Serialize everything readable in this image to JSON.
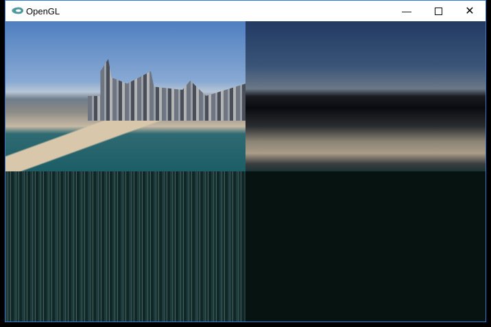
{
  "window": {
    "title": "OpenGL",
    "icon": "opengl-icon",
    "controls": [
      "minimize-icon",
      "maximize-icon",
      "close-icon"
    ]
  }
}
